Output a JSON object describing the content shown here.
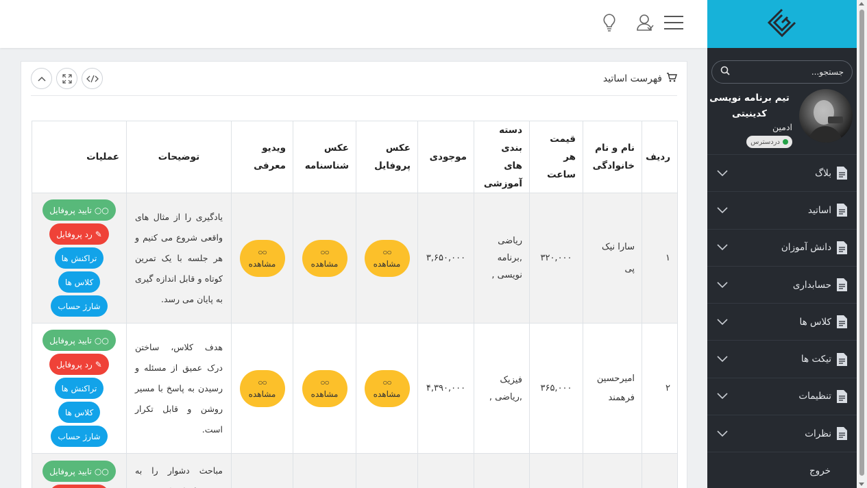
{
  "sidebar": {
    "search_placeholder": "جستجو...",
    "profile": {
      "name": "تیم برنامه نویسی کدینیتی",
      "role": "ادمین",
      "status": "دردسترس"
    },
    "menu": [
      {
        "label": "بلاگ"
      },
      {
        "label": "اساتید"
      },
      {
        "label": "دانش آموزان"
      },
      {
        "label": "حسابداری"
      },
      {
        "label": "کلاس ها"
      },
      {
        "label": "تیکت ها"
      },
      {
        "label": "تنظیمات"
      },
      {
        "label": "نظرات"
      }
    ],
    "logout": "خروج"
  },
  "card": {
    "title": "فهرست اساتید",
    "tools": [
      "code-icon",
      "fullscreen-icon",
      "collapse-icon"
    ]
  },
  "table": {
    "headers": [
      "ردیف",
      "نام و نام خانوادگی",
      "قیمت هر ساعت",
      "دسته بندی های آموزشی",
      "موجودی",
      "عکس پروفایل",
      "عکس شناسنامه",
      "ویدیو معرفی",
      "توضیحات",
      "عملیات"
    ],
    "view_label": "مشاهده",
    "ops": {
      "approve": "تایید پروفایل",
      "reject": "رد پروفایل",
      "transactions": "تراکنش ها",
      "classes": "کلاس ها",
      "charge": "شارژ حساب"
    },
    "rows": [
      {
        "index": "۱",
        "name": "سارا نیک پی",
        "price": "۳۲۰,۰۰۰",
        "categories": "ریاضی ,برنامه نویسی ,",
        "balance": "۳,۶۵۰,۰۰۰",
        "description": "یادگیری را از مثال های واقعی شروع می کنیم و هر جلسه با یک تمرین کوتاه و قابل اندازه گیری به پایان می رسد."
      },
      {
        "index": "۲",
        "name": "امیرحسین فرهمند",
        "price": "۳۶۵,۰۰۰",
        "categories": "فیزیک ,ریاضی ,",
        "balance": "۴,۳۹۰,۰۰۰",
        "description": "هدف کلاس، ساختن درک عمیق از مسئله و رسیدن به پاسخ با مسیر روشن و قابل تکرار است."
      },
      {
        "index": "",
        "name": "",
        "price": "",
        "categories": "",
        "balance": "",
        "description": "مباحث دشوار را به بخش های کوچک"
      }
    ]
  },
  "colors": {
    "brand": "#17b2d9",
    "sidebar_bg": "#262a30",
    "view_button": "#fcc02a",
    "approve": "#58b97a",
    "reject": "#ef4238",
    "info": "#12a3e9"
  }
}
